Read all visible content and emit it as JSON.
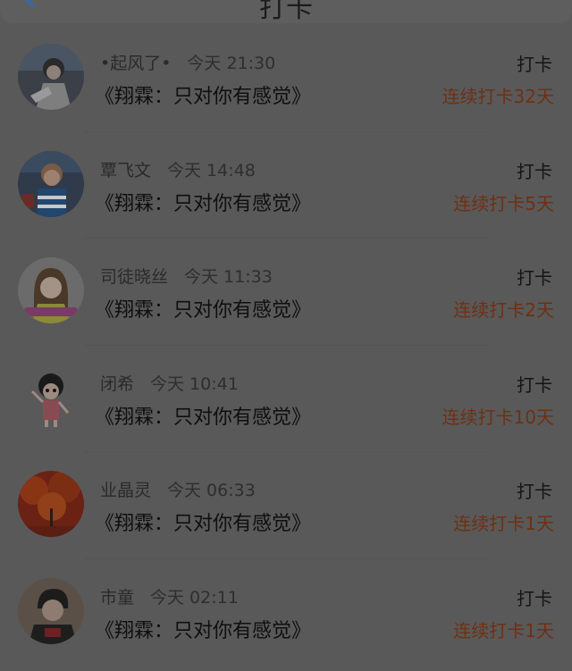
{
  "header": {
    "title": "打卡"
  },
  "entries": [
    {
      "name": "•起风了•",
      "time": "今天 21:30",
      "title": "《翔霖：只对你有感觉》",
      "checkin_label": "打卡",
      "streak": "连续打卡32天",
      "avatar_icon": "avatar-girl-dark"
    },
    {
      "name": "覃飞文",
      "time": "今天 14:48",
      "title": "《翔霖：只对你有感觉》",
      "checkin_label": "打卡",
      "streak": "连续打卡5天",
      "avatar_icon": "avatar-child-colorful"
    },
    {
      "name": "司徒晓丝",
      "time": "今天 11:33",
      "title": "《翔霖：只对你有感觉》",
      "checkin_label": "打卡",
      "streak": "连续打卡2天",
      "avatar_icon": "avatar-girl-pink"
    },
    {
      "name": "闭希",
      "time": "今天 10:41",
      "title": "《翔霖：只对你有感觉》",
      "checkin_label": "打卡",
      "streak": "连续打卡10天",
      "avatar_icon": "avatar-cartoon-girl"
    },
    {
      "name": "业晶灵",
      "time": "今天 06:33",
      "title": "《翔霖：只对你有感觉》",
      "checkin_label": "打卡",
      "streak": "连续打卡1天",
      "avatar_icon": "avatar-autumn-trees"
    },
    {
      "name": "市童",
      "time": "今天 02:11",
      "title": "《翔霖：只对你有感觉》",
      "checkin_label": "打卡",
      "streak": "连续打卡1天",
      "avatar_icon": "avatar-boy-dark"
    }
  ]
}
